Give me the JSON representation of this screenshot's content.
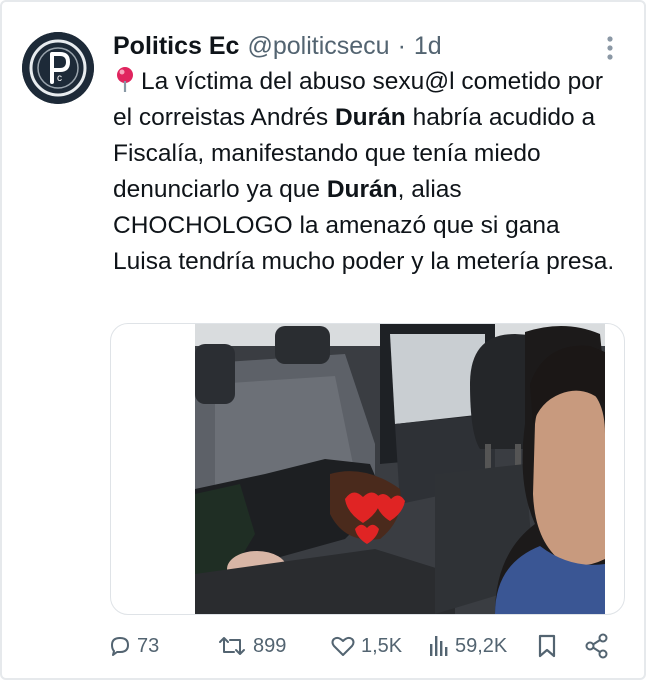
{
  "tweet": {
    "author_name": "Politics Ec",
    "handle": "@politicsecu",
    "separator": "·",
    "time": "1d",
    "text_segments": [
      {
        "text": "La víctima del abuso sexu@l cometido por el correistas Andrés ",
        "bold": false
      },
      {
        "text": "Durán",
        "bold": true
      },
      {
        "text": " habría acudido a Fiscalía, manifestando que tenía miedo denunciarlo ya que ",
        "bold": false
      },
      {
        "text": "Durán",
        "bold": true
      },
      {
        "text": ", alias CHOCHOLOGO la amenazó que si gana Luisa tendría mucho poder y la metería presa.",
        "bold": false
      }
    ],
    "leading_icon": "round-pushpin-icon",
    "avatar_letters": "Pc"
  },
  "actions": {
    "replies": "73",
    "reposts": "899",
    "likes": "1,5K",
    "views": "59,2K"
  },
  "colors": {
    "text": "#0f1419",
    "secondary": "#536471",
    "border": "#e6e9ec",
    "pin": "#e0245e"
  }
}
